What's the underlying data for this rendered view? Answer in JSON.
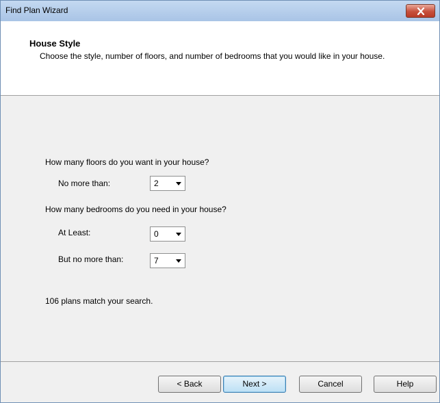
{
  "window": {
    "title": "Find Plan Wizard"
  },
  "header": {
    "title": "House Style",
    "description": "Choose the style, number of floors, and number of bedrooms that you would like in your house."
  },
  "floors": {
    "question": "How many floors do you want in your house?",
    "max_label": "No more than:",
    "max_value": "2"
  },
  "bedrooms": {
    "question": "How many bedrooms do you need in your house?",
    "min_label": "At Least:",
    "min_value": "0",
    "max_label": "But no more than:",
    "max_value": "7"
  },
  "status": "106 plans match your search.",
  "buttons": {
    "back": "< Back",
    "next": "Next >",
    "cancel": "Cancel",
    "help": "Help"
  },
  "icons": {
    "close": "close-icon",
    "dropdown": "chevron-down-icon"
  },
  "colors": {
    "close_button": "#c7503c",
    "default_button_border": "#3c7fb1",
    "dialog_background": "#f0f0f0"
  }
}
